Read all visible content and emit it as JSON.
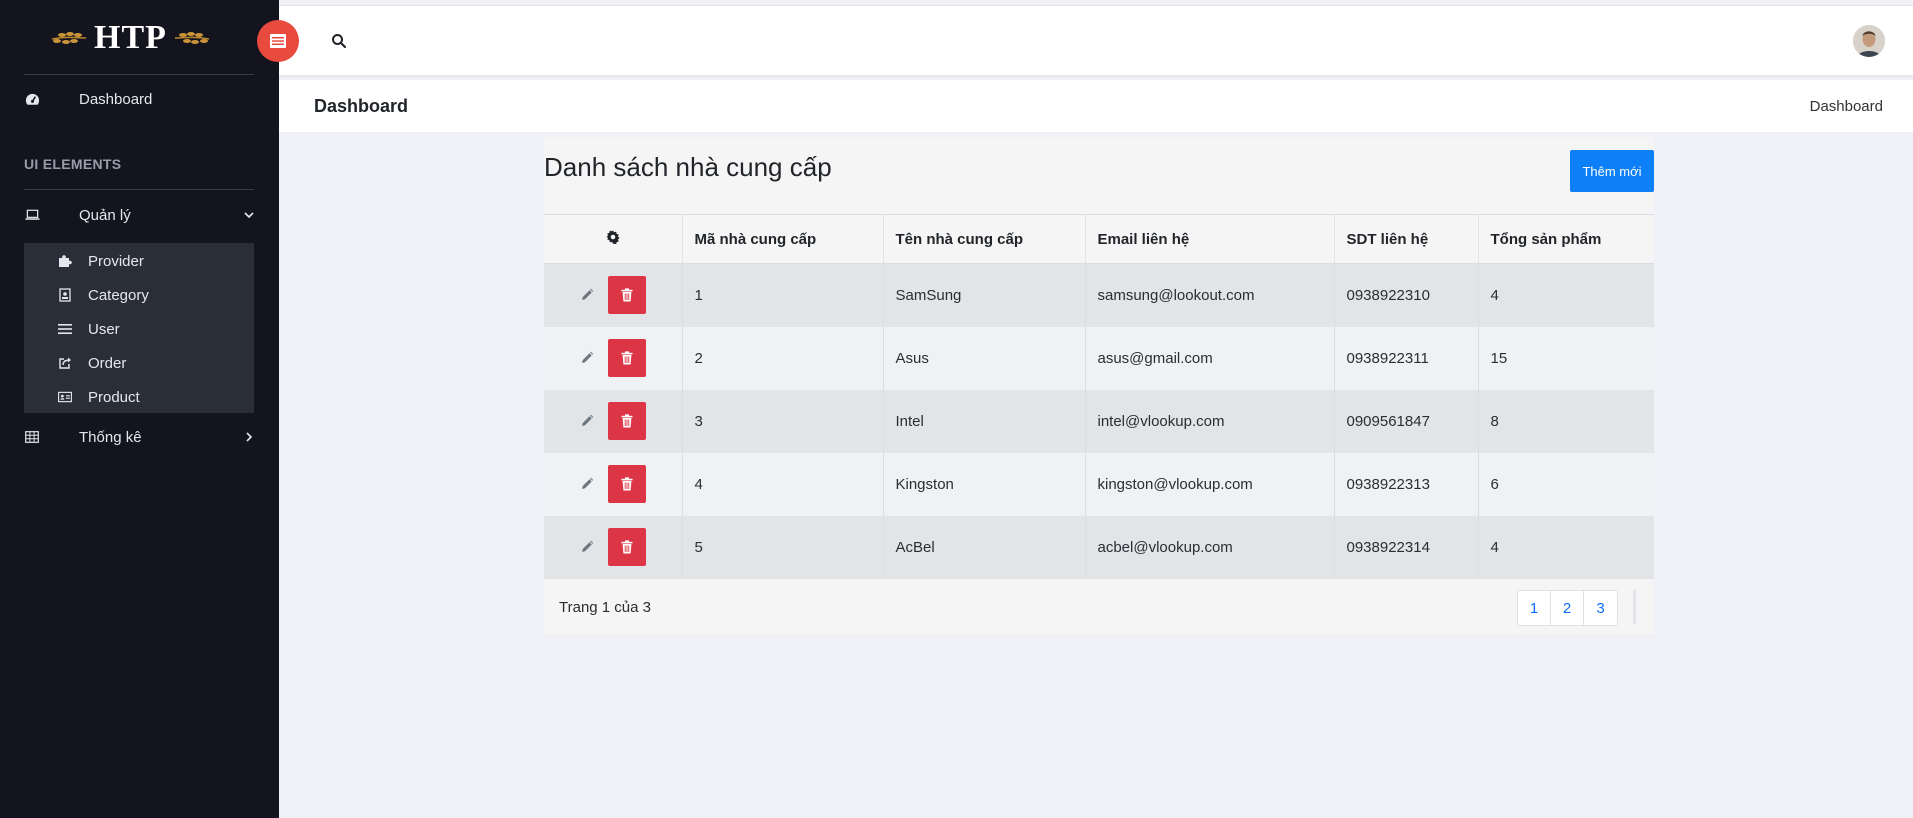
{
  "brand": {
    "logo_text": "HTP"
  },
  "sidebar": {
    "dashboard_label": "Dashboard",
    "section_label": "UI ELEMENTS",
    "quanly_label": "Quản lý",
    "sub_items": [
      {
        "label": "Provider",
        "icon": "puzzle-icon"
      },
      {
        "label": "Category",
        "icon": "id-badge-icon"
      },
      {
        "label": "User",
        "icon": "list-icon"
      },
      {
        "label": "Order",
        "icon": "share-icon"
      },
      {
        "label": "Product",
        "icon": "id-card-icon"
      }
    ],
    "thongke_label": "Thống kê"
  },
  "page": {
    "title": "Dashboard",
    "breadcrumb": "Dashboard"
  },
  "card": {
    "title": "Danh sách nhà cung cấp",
    "add_label": "Thêm mới",
    "columns": [
      "Mã nhà cung cấp",
      "Tên nhà cung cấp",
      "Email liên hệ",
      "SDT liên hệ",
      "Tổng sản phẩm"
    ],
    "rows": [
      {
        "id": "1",
        "name": "SamSung",
        "email": "samsung@lookout.com",
        "phone": "0938922310",
        "total": "4"
      },
      {
        "id": "2",
        "name": "Asus",
        "email": "asus@gmail.com",
        "phone": "0938922311",
        "total": "15"
      },
      {
        "id": "3",
        "name": "Intel",
        "email": "intel@vlookup.com",
        "phone": "0909561847",
        "total": "8"
      },
      {
        "id": "4",
        "name": "Kingston",
        "email": "kingston@vlookup.com",
        "phone": "0938922313",
        "total": "6"
      },
      {
        "id": "5",
        "name": "AcBel",
        "email": "acbel@vlookup.com",
        "phone": "0938922314",
        "total": "4"
      }
    ],
    "page_info": "Trang 1 của 3",
    "pages": [
      "1",
      "2",
      "3"
    ]
  },
  "colors": {
    "sidebar_bg": "#13141d",
    "toggle": "#e84a3e",
    "primary": "#0d7ff7",
    "danger": "#dc3545"
  }
}
